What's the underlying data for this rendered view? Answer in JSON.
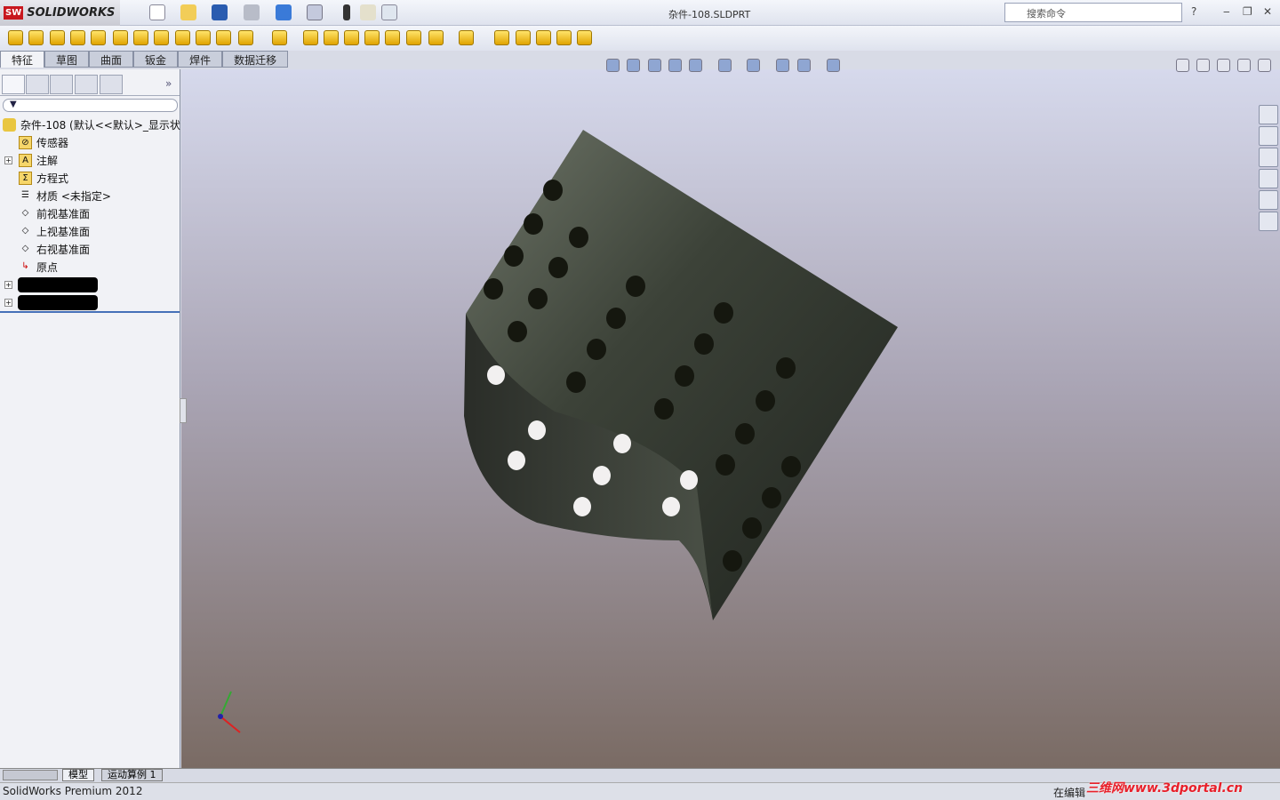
{
  "app": {
    "brand": "SOLIDWORKS",
    "title": "杂件-108.SLDPRT",
    "search_placeholder": "搜索命令",
    "help": "?"
  },
  "tabs": [
    {
      "label": "特征",
      "active": true
    },
    {
      "label": "草图"
    },
    {
      "label": "曲面"
    },
    {
      "label": "钣金"
    },
    {
      "label": "焊件"
    },
    {
      "label": "数据迁移"
    }
  ],
  "tree": {
    "root": "杂件-108  (默认<<默认>_显示状",
    "items": [
      {
        "label": "传感器",
        "icon": "sensor-folder-icon",
        "expand": false
      },
      {
        "label": "注解",
        "icon": "annotation-folder-icon",
        "expand": true
      },
      {
        "label": "方程式",
        "icon": "equation-folder-icon",
        "expand": false
      },
      {
        "label": "材质 <未指定>",
        "icon": "material-icon",
        "expand": false
      },
      {
        "label": "前视基准面",
        "icon": "plane-icon",
        "expand": false
      },
      {
        "label": "上视基准面",
        "icon": "plane-icon",
        "expand": false
      },
      {
        "label": "右视基准面",
        "icon": "plane-icon",
        "expand": false
      },
      {
        "label": "原点",
        "icon": "origin-icon",
        "expand": false
      }
    ]
  },
  "bottom_tabs": [
    "模型",
    "运动算例 1"
  ],
  "status": {
    "left": "SolidWorks Premium 2012",
    "right": "在编辑"
  },
  "watermark": "三维网www.3dportal.cn",
  "colors": {
    "viewport_top": "#d6d9ec",
    "viewport_bottom": "#7a6b64",
    "accent": "#4670b8"
  }
}
